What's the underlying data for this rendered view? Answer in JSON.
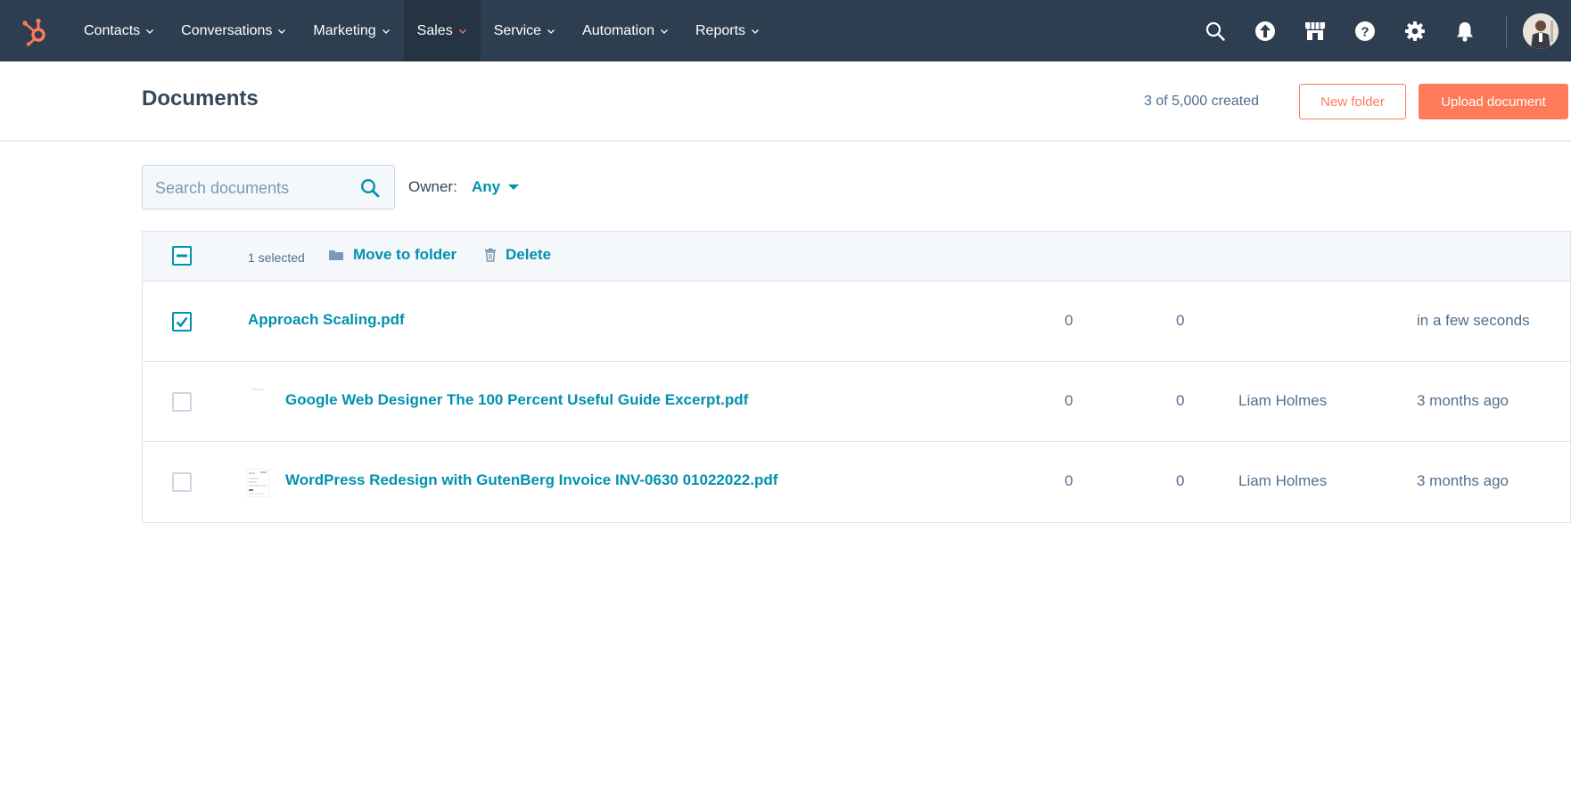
{
  "nav": {
    "items": [
      {
        "label": "Contacts"
      },
      {
        "label": "Conversations"
      },
      {
        "label": "Marketing"
      },
      {
        "label": "Sales"
      },
      {
        "label": "Service"
      },
      {
        "label": "Automation"
      },
      {
        "label": "Reports"
      }
    ],
    "active_item": "Sales",
    "icons": [
      "search-icon",
      "upgrade-arrow-icon",
      "marketplace-icon",
      "help-icon",
      "settings-icon",
      "notifications-bell-icon"
    ],
    "colors": {
      "bar": "#2d3e50",
      "active": "#253342",
      "accent": "#ff7a59"
    }
  },
  "header": {
    "title": "Documents",
    "created_count": "3 of 5,000 created",
    "new_folder_label": "New folder",
    "upload_label": "Upload document"
  },
  "filters": {
    "search_placeholder": "Search documents",
    "owner_label": "Owner:",
    "owner_value": "Any"
  },
  "bulk_bar": {
    "selected_count": "1 selected",
    "move_label": "Move to folder",
    "delete_label": "Delete"
  },
  "documents": [
    {
      "name": "Approach Scaling.pdf",
      "col1": "0",
      "col2": "0",
      "owner": "",
      "updated": "in a few seconds",
      "checked": true
    },
    {
      "name": "Google Web Designer The 100 Percent Useful Guide Excerpt.pdf",
      "col1": "0",
      "col2": "0",
      "owner": "Liam Holmes",
      "updated": "3 months ago",
      "checked": false
    },
    {
      "name": "WordPress Redesign with GutenBerg Invoice INV-0630 01022022.pdf",
      "col1": "0",
      "col2": "0",
      "owner": "Liam Holmes",
      "updated": "3 months ago",
      "checked": false
    }
  ],
  "colors": {
    "link": "#0091ae",
    "text": "#33475b",
    "muted": "#516f90",
    "primary_button": "#ff7a59"
  }
}
